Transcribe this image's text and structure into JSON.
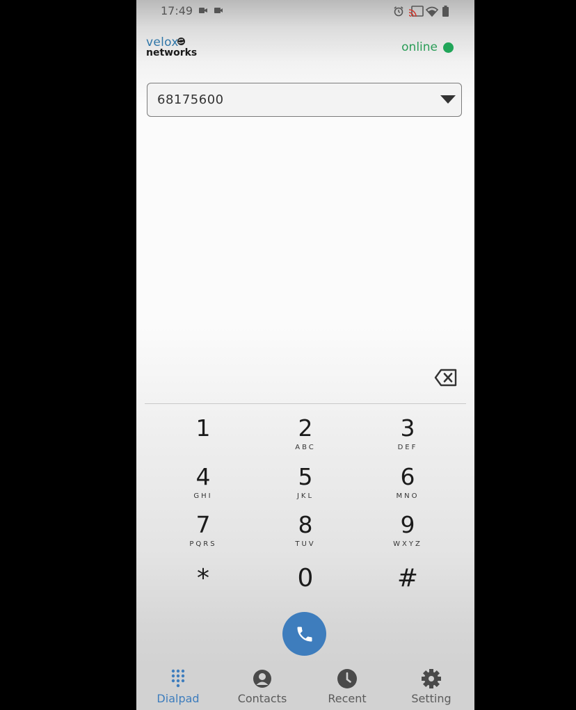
{
  "status_bar": {
    "time": "17:49"
  },
  "header": {
    "brand_line1": "velox",
    "brand_line2": "networks",
    "status_label": "online",
    "status_color": "#21a559"
  },
  "account_select": {
    "value": "68175600"
  },
  "dialpad": {
    "keys": [
      {
        "digit": "1",
        "letters": ""
      },
      {
        "digit": "2",
        "letters": "ABC"
      },
      {
        "digit": "3",
        "letters": "DEF"
      },
      {
        "digit": "4",
        "letters": "GHI"
      },
      {
        "digit": "5",
        "letters": "JKL"
      },
      {
        "digit": "6",
        "letters": "MNO"
      },
      {
        "digit": "7",
        "letters": "PQRS"
      },
      {
        "digit": "8",
        "letters": "TUV"
      },
      {
        "digit": "9",
        "letters": "WXYZ"
      },
      {
        "digit": "*",
        "letters": ""
      },
      {
        "digit": "0",
        "letters": ""
      },
      {
        "digit": "#",
        "letters": ""
      }
    ]
  },
  "call_button": {
    "icon": "phone-icon",
    "color": "#3e7dbd"
  },
  "tabs": [
    {
      "label": "Dialpad",
      "icon": "dialpad-icon",
      "active": true
    },
    {
      "label": "Contacts",
      "icon": "contact-icon",
      "active": false
    },
    {
      "label": "Recent",
      "icon": "clock-icon",
      "active": false
    },
    {
      "label": "Setting",
      "icon": "gear-icon",
      "active": false
    }
  ]
}
